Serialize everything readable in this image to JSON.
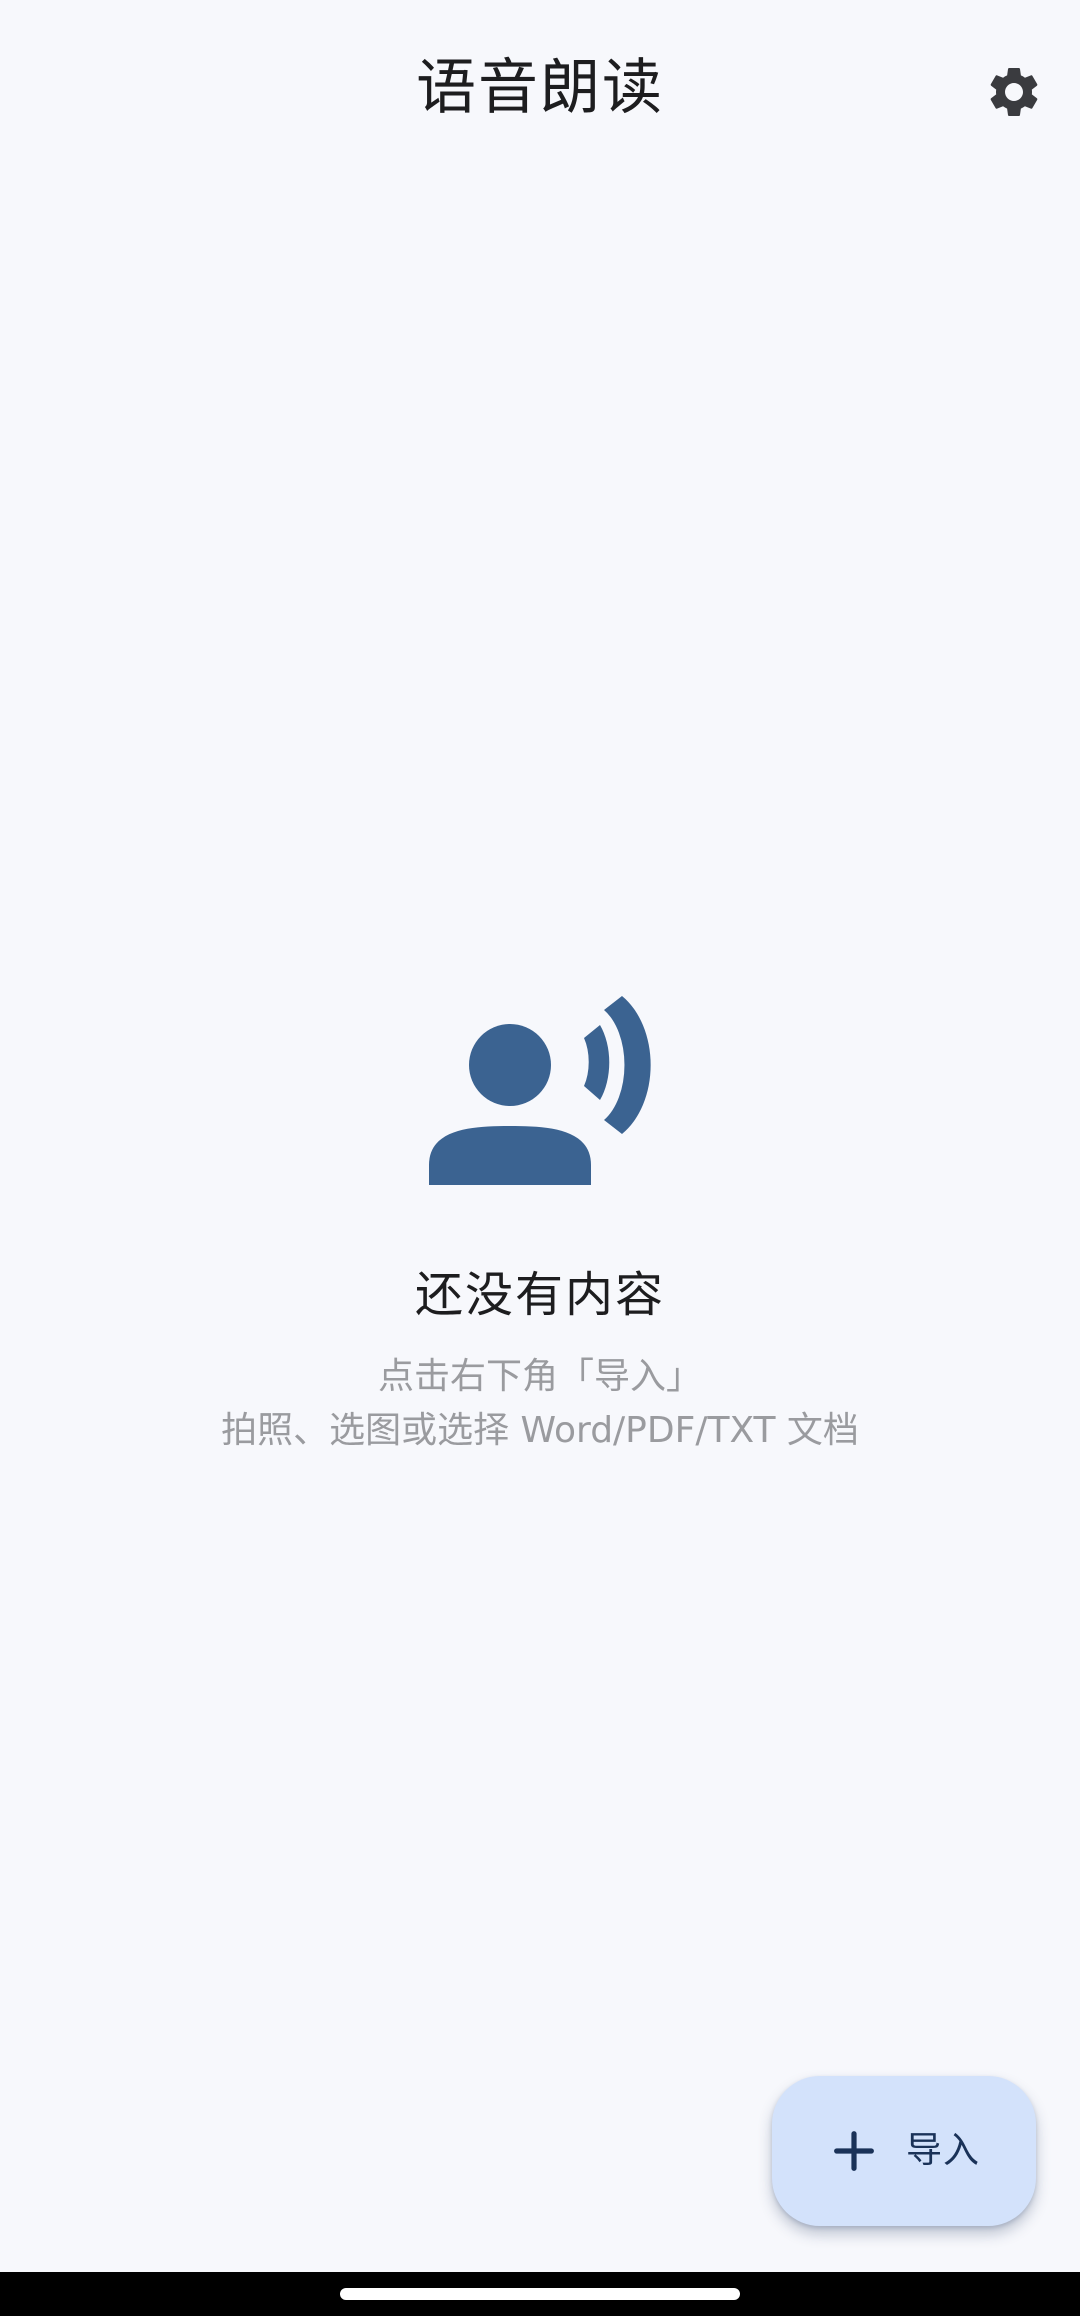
{
  "app_bar": {
    "title": "语音朗读",
    "settings_icon": "gear-icon"
  },
  "empty_state": {
    "illustration_icon": "record-voice-icon",
    "title": "还没有内容",
    "hint_line_1": "点击右下角「导入」",
    "hint_line_2": "拍照、选图或选择 Word/PDF/TXT 文档"
  },
  "fab": {
    "icon": "plus-icon",
    "label": "导入"
  },
  "colors": {
    "background": "#f7f8fc",
    "accent": "#3b6391",
    "fab_background": "#d3e2fb",
    "fab_foreground": "#1a3258"
  }
}
